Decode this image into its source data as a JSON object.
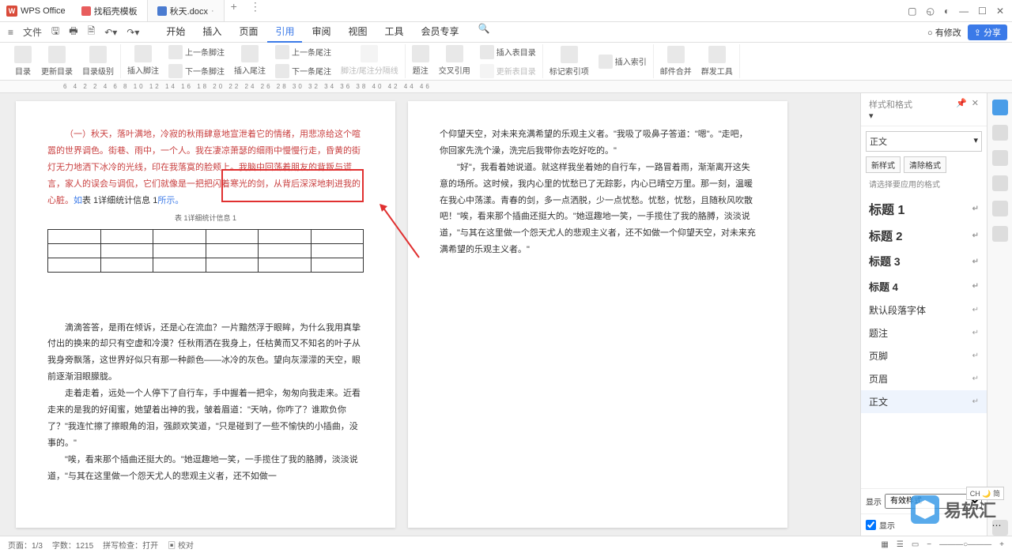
{
  "app": {
    "name": "WPS Office"
  },
  "tabs": [
    {
      "label": "找稻壳模板"
    },
    {
      "label": "秋天.docx",
      "modified": "·"
    }
  ],
  "win": {
    "search": "⌕"
  },
  "menu": {
    "file": "文件",
    "items": [
      "开始",
      "插入",
      "页面",
      "引用",
      "审阅",
      "视图",
      "工具",
      "会员专享"
    ],
    "active": 3,
    "hasChanges": "有修改",
    "share": "分享"
  },
  "toolbar": {
    "toc": "目录",
    "updateToc": "更新目录",
    "tocLevel": "目录级别",
    "insertFootnote": "插入脚注",
    "prevFootnote": "上一条脚注",
    "nextFootnote": "下一条脚注",
    "insertEndnote": "插入尾注",
    "prevEndnote": "上一条尾注",
    "nextEndnote": "下一条尾注",
    "noteSep": "脚注/尾注分隔线",
    "caption": "题注",
    "crossRef": "交叉引用",
    "insertTableFig": "插入表目录",
    "updateTableFig": "更新表目录",
    "markIndex": "标记索引项",
    "insertIndex": "插入索引",
    "mailMerge": "邮件合并",
    "massTools": "群发工具"
  },
  "ruler": "6   4   2       2   4   6   8   10   12   14   16   18   20   22   24   26   28   30   32   34   36   38   40   42   44   46",
  "doc": {
    "p1_red": "（一）秋天，落叶满地，冷寂的秋雨肆意地宣泄着它的情绪，用悲凉给这个喧嚣的世界调色。街巷、雨中，一个人。我在凄凉萧瑟的细雨中慢慢行走，昏黄的街灯无力地洒下冰冷的光线，印在我落寞的脸颊上。我脑中回荡着朋友的背叛与谎言，家人的误会与调侃，它们就像是一把把闪着寒光的剑，从背后深深地刺进我的心脏。",
    "p1_insert": "如",
    "p1_insert_ref": "表 1详细统计信息 1",
    "p1_insert_end": "所示。",
    "caption": "表 1详细统计信息 1",
    "p2": "滴滴答答，是雨在倾诉，还是心在流血？一片黯然浮于眼眸，为什么我用真挚付出的换来的却只有空虚和冷漠？任秋雨洒在我身上，任枯黄而又不知名的叶子从我身旁飘落，这世界好似只有那一种颜色——冰冷的灰色。望向灰濛濛的天空，眼前逐渐泪眼朦胧。",
    "p3a": "走着走着，远处一个人停下了自行车，手中握着一把伞，匆匆向我走来。近看走来的是我的好闺蜜，她望着出神的我，皱着眉道：\"天呐，你咋了？谁欺负你了？\"我连忙擦了擦眼角的泪，强颜欢笑道，\"只是碰到了一些不愉快的小插曲，没事的。\"",
    "p3b": "\"唉，看来那个插曲还挺大的。\"她逗趣地一笑，一手揽住了我的胳膊，淡淡说道，\"与其在这里做一个怨天尤人的悲观主义者，还不如做一",
    "p4a": "个仰望天空，对未来充满希望的乐观主义者。\"我吸了吸鼻子答道：\"嗯\"。\"走吧，你回家先洗个澡，洗完后我带你去吃好吃的。\"",
    "p4b": "\"好\"，我看着她说道。就这样我坐着她的自行车，一路冒着雨，渐渐离开这失意的场所。这时候，我内心里的忧愁已了无踪影，内心已晴空万里。那一刻，温暖在我心中荡漾。青春的剑，多一点洒脱，少一点忧愁。忧愁，忧愁，且随秋风吹散吧！\"唉，看来那个插曲还挺大的。\"她逗趣地一笑，一手揽住了我的胳膊，淡淡说道，\"与其在这里做一个怨天尤人的悲观主义者，还不如做一个仰望天空，对未来充满希望的乐观主义者。\""
  },
  "panel": {
    "title": "样式和格式",
    "current": "正文",
    "newStyle": "新样式",
    "clearFmt": "清除格式",
    "hint": "请选择要应用的格式",
    "styles": [
      {
        "label": "标题 1",
        "cls": "h1"
      },
      {
        "label": "标题 2",
        "cls": "h2"
      },
      {
        "label": "标题 3",
        "cls": "h3"
      },
      {
        "label": "标题 4",
        "cls": "h4"
      },
      {
        "label": "默认段落字体",
        "cls": ""
      },
      {
        "label": "题注",
        "cls": ""
      },
      {
        "label": "页脚",
        "cls": ""
      },
      {
        "label": "页眉",
        "cls": ""
      },
      {
        "label": "正文",
        "cls": "",
        "active": true
      }
    ],
    "showLabel": "显示",
    "showValue": "有效样式",
    "showCheck": "显示"
  },
  "status": {
    "page": "页面：1/3",
    "words": "字数：1215",
    "spell": "拼写检查：打开",
    "proof": "校对"
  },
  "ime": "CH 🌙 简",
  "watermark": "易软汇"
}
